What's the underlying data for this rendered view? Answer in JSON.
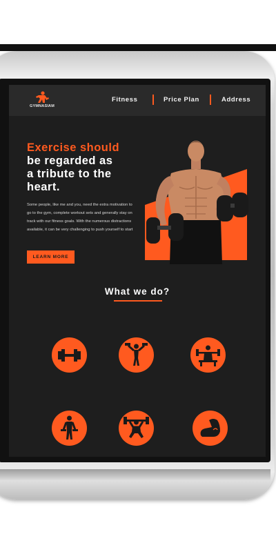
{
  "logo": {
    "text": "GYMNASIAM",
    "icon": "athlete-icon"
  },
  "nav": {
    "items": [
      "Fitness",
      "Price Plan",
      "Address"
    ]
  },
  "hero": {
    "title_accent": "Exercise should",
    "title_lines": [
      "be regarded as",
      "a tribute to the",
      "heart."
    ],
    "body": "Some people, like me and you, need the extra motivation to go to the gym, complete workout sets and generally stay on track with our fitness goals. With the numerous distractions available, it can be very challenging to push yourself to start",
    "button": "LEARN MORE",
    "image": "muscular-man-holding-dumbbells"
  },
  "services": {
    "title": "What we do?",
    "icons": [
      "barbell-icon",
      "dumbbell-overhead-icon",
      "bench-press-icon",
      "dumbbell-stand-icon",
      "squat-press-icon",
      "flexed-arm-icon"
    ]
  },
  "colors": {
    "accent": "#ff5a1f",
    "background": "#1e1e1e",
    "nav": "#2a2a2a"
  }
}
